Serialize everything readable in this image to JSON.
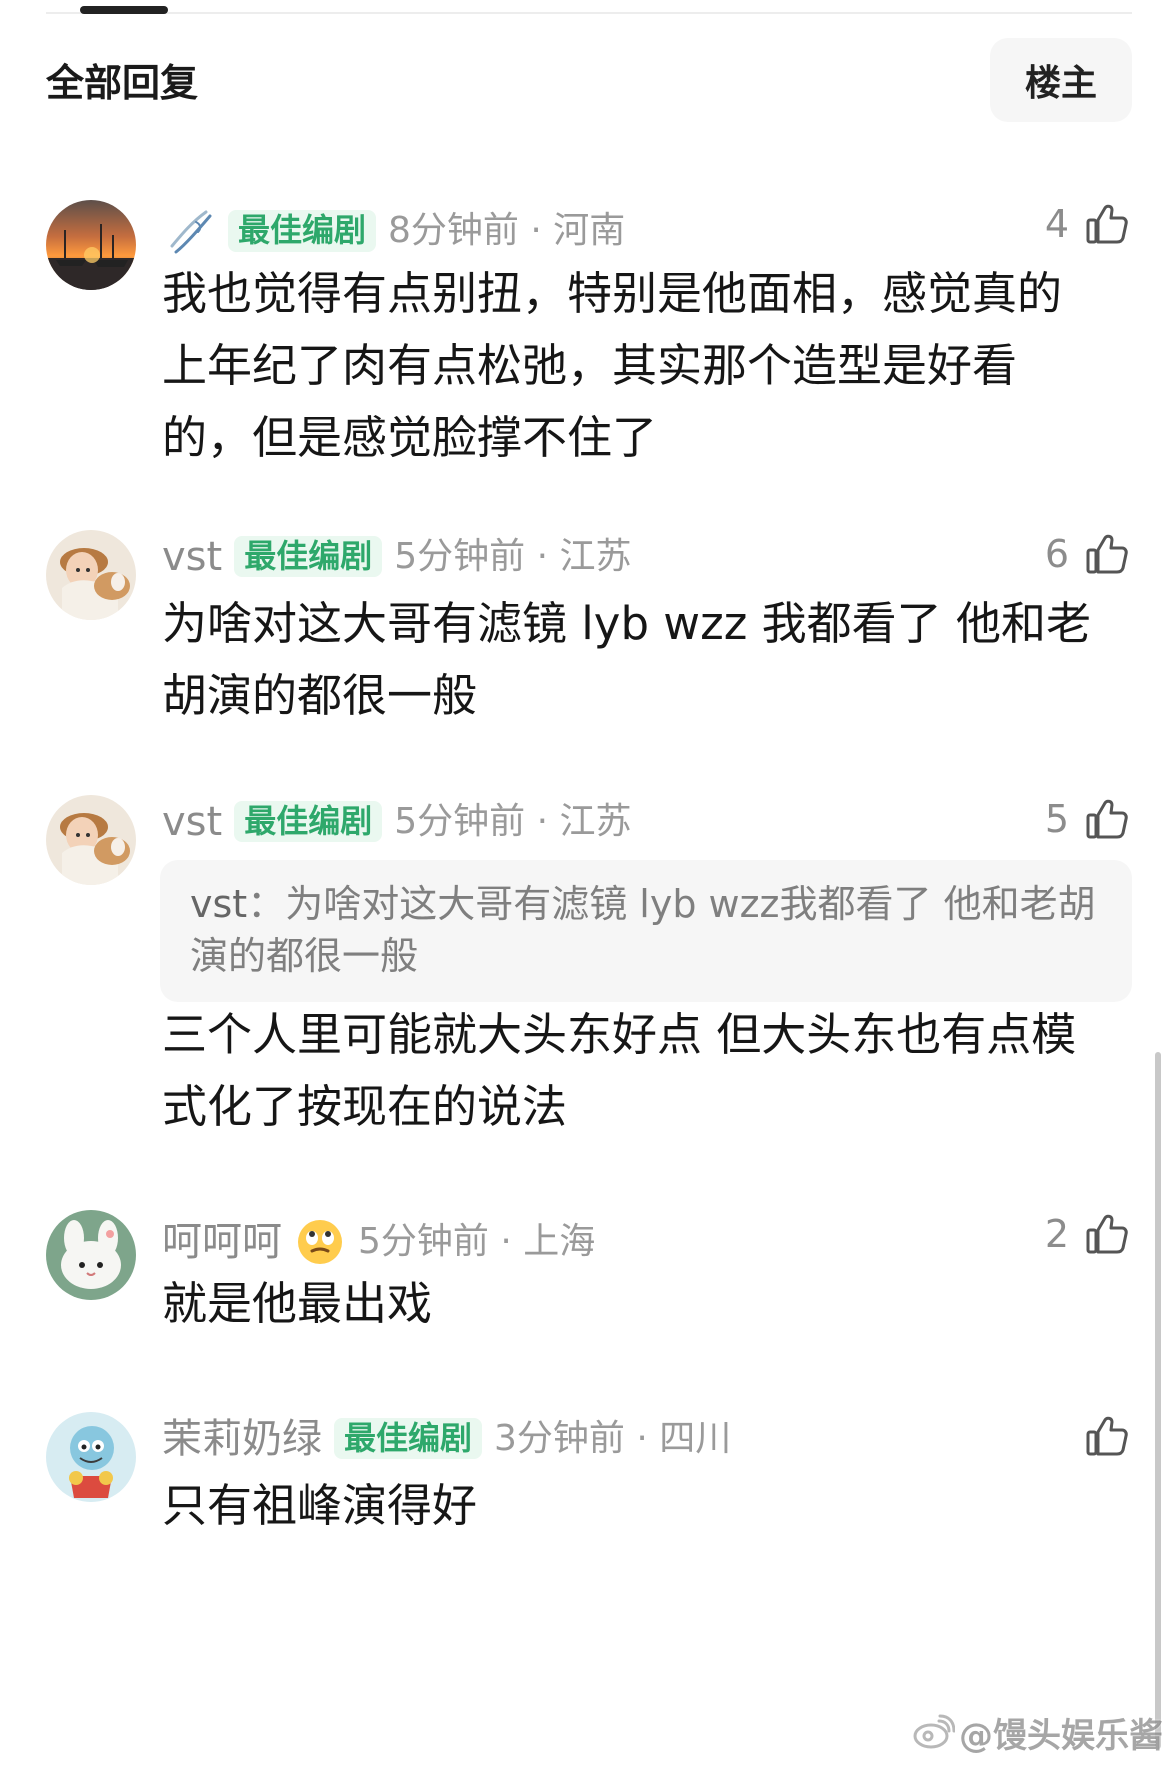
{
  "header": {
    "title": "全部回复",
    "owner_button": "楼主"
  },
  "comments": [
    {
      "username": "",
      "badge": "最佳编剧",
      "time_location": "8分钟前 · 河南",
      "likes": "4",
      "text": "我也觉得有点别扭，特别是他面相，感觉真的上年纪了肉有点松弛，其实那个造型是好看的，但是感觉脸撑不住了",
      "avatar_icon": "sunset-boat-avatar"
    },
    {
      "username": "vst",
      "badge": "最佳编剧",
      "time_location": "5分钟前 · 江苏",
      "likes": "6",
      "text": "为啥对这大哥有滤镜 lyb wzz 我都看了 他和老胡演的都很一般",
      "avatar_icon": "child-dog-avatar"
    },
    {
      "username": "vst",
      "badge": "最佳编剧",
      "time_location": "5分钟前 · 江苏",
      "likes": "5",
      "quote_user": "vst",
      "quote_text": "为啥对这大哥有滤镜 lyb wzz我都看了 他和老胡演的都很一般",
      "text": "三个人里可能就大头东好点 但大头东也有点模式化了按现在的说法",
      "avatar_icon": "child-dog-avatar"
    },
    {
      "username": "呵呵呵",
      "badge": "",
      "time_location": "5分钟前 · 上海",
      "likes": "2",
      "text": "就是他最出戏",
      "avatar_icon": "plush-bunny-avatar",
      "emoji_icon": "rolling-eyes-emoji"
    },
    {
      "username": "茉莉奶绿",
      "badge": "最佳编剧",
      "time_location": "3分钟前 · 四川",
      "likes": "",
      "text": "只有祖峰演得好",
      "avatar_icon": "cartoon-character-avatar"
    }
  ],
  "watermark": {
    "text": "@馒头娱乐酱"
  },
  "colors": {
    "badge_bg": "#eaf8f0",
    "badge_text": "#2ea86b",
    "muted_text": "#8e8e8e",
    "body_text": "#161616"
  }
}
